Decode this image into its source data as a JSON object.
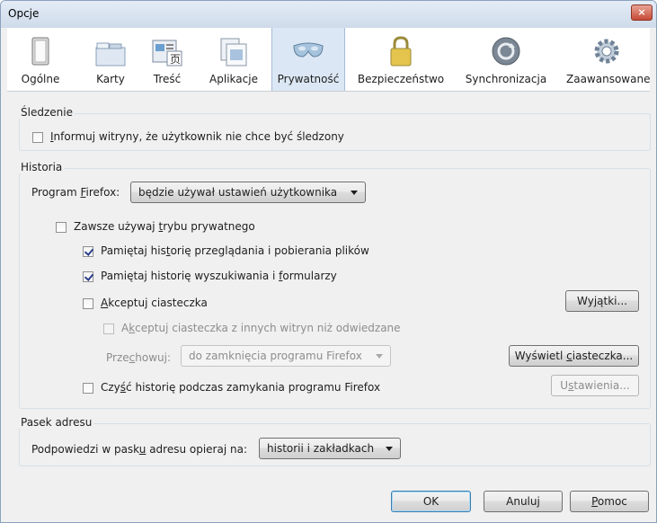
{
  "window": {
    "title": "Opcje",
    "close_glyph": "×"
  },
  "tabs": [
    {
      "label": "Ogólne",
      "icon": "general-icon"
    },
    {
      "label": "Karty",
      "icon": "tabs-icon"
    },
    {
      "label": "Treść",
      "icon": "content-icon"
    },
    {
      "label": "Aplikacje",
      "icon": "applications-icon"
    },
    {
      "label": "Prywatność",
      "icon": "privacy-mask-icon",
      "selected": true
    },
    {
      "label": "Bezpieczeństwo",
      "icon": "padlock-icon"
    },
    {
      "label": "Synchronizacja",
      "icon": "sync-icon"
    },
    {
      "label": "Zaawansowane",
      "icon": "gear-icon"
    }
  ],
  "tracking": {
    "title": "Śledzenie",
    "dnt_label_u": "I",
    "dnt_label_rest": "nformuj witryny, że użytkownik nie chce być śledzony",
    "dnt_checked": false
  },
  "history": {
    "title": "Historia",
    "program_label_pre": "Program ",
    "program_label_u": "F",
    "program_label_post": "irefox:",
    "mode_value": "będzie używał ustawień użytkownika",
    "always_private_pre": "Zawsze używaj ",
    "always_private_u": "t",
    "always_private_post": "rybu prywatnego",
    "always_private_checked": false,
    "remember_browsing_pre": "Pamiętaj his",
    "remember_browsing_u": "t",
    "remember_browsing_post": "orię przeglądania i pobierania plików",
    "remember_browsing_checked": true,
    "remember_search_pre": "Pamiętaj historię wyszukiwania i ",
    "remember_search_u": "f",
    "remember_search_post": "ormularzy",
    "remember_search_checked": true,
    "accept_cookies_u": "A",
    "accept_cookies_post": "kceptuj ciasteczka",
    "accept_cookies_checked": false,
    "exceptions_pre": "Wy",
    "exceptions_u": "j",
    "exceptions_post": "ątki...",
    "third_party_pre": "A",
    "third_party_u": "k",
    "third_party_post": "ceptuj ciasteczka z innych witryn niż odwiedzane",
    "third_party_checked": false,
    "keep_label_pre": "Prze",
    "keep_label_u": "c",
    "keep_label_post": "howuj:",
    "keep_value": "do zamknięcia programu Firefox",
    "show_cookies_pre": "Wyświetl ",
    "show_cookies_u": "c",
    "show_cookies_post": "iasteczka...",
    "clear_pre": "Czy",
    "clear_u": "ś",
    "clear_post": "ć historię podczas zamykania programu Firefox",
    "clear_checked": false,
    "settings_pre": "U",
    "settings_u": "s",
    "settings_post": "tawienia..."
  },
  "addressbar": {
    "title": "Pasek adresu",
    "label_pre": "Podpowiedzi w pask",
    "label_u": "u",
    "label_post": " adresu opieraj na:",
    "value": "historii i zakładkach"
  },
  "buttons": {
    "ok": "OK",
    "cancel": "Anuluj",
    "help_u": "P",
    "help_post": "omoc"
  }
}
